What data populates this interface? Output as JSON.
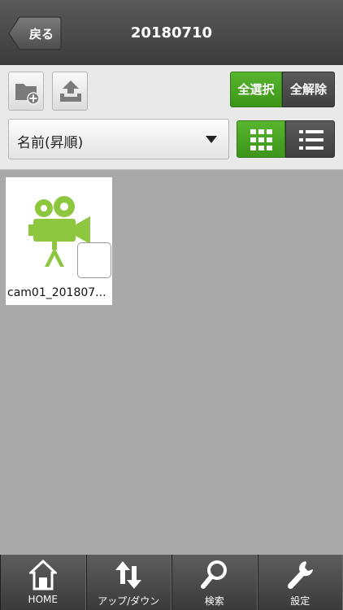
{
  "header": {
    "back_label": "戻る",
    "title": "20180710"
  },
  "toolbar": {
    "new_folder_icon": "folder-plus-icon",
    "upload_icon": "upload-tray-icon",
    "select_all_label": "全選択",
    "deselect_all_label": "全解除",
    "sort": {
      "selected": "名前(昇順)"
    },
    "view_modes": {
      "grid_icon": "grid-icon",
      "list_icon": "list-icon",
      "active": "grid"
    }
  },
  "files": [
    {
      "name": "cam01_201807...",
      "icon": "video-camera-icon",
      "checked": false
    }
  ],
  "bottom_nav": {
    "items": [
      {
        "label": "HOME",
        "icon": "home-icon"
      },
      {
        "label": "アップ/ダウン",
        "icon": "up-down-arrows-icon"
      },
      {
        "label": "検索",
        "icon": "search-icon"
      },
      {
        "label": "設定",
        "icon": "wrench-icon"
      }
    ]
  },
  "colors": {
    "accent_green": "#4caf26",
    "header_dark": "#4a4a4a",
    "background": "#a9a9a9",
    "file_icon_green": "#8dc63f"
  }
}
